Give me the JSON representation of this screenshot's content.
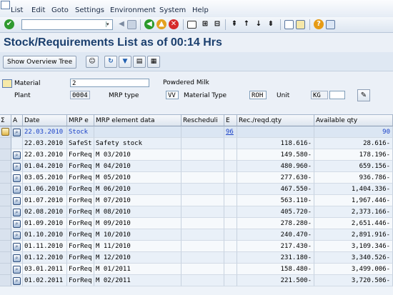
{
  "menu": [
    "List",
    "Edit",
    "Goto",
    "Settings",
    "Environment",
    "System",
    "Help"
  ],
  "toolbar": {
    "command_value": "",
    "icons": [
      "check-icon",
      "back-arrow-icon",
      "save-icon",
      "back-icon",
      "exit-icon",
      "cancel-icon",
      "print-icon",
      "find-icon",
      "find-next-icon",
      "first-page-icon",
      "prev-page-icon",
      "next-page-icon",
      "last-page-icon",
      "new-session-icon",
      "shortcut-icon",
      "help-icon",
      "layout-icon"
    ]
  },
  "title": "Stock/Requirements List as of 00:14 Hrs",
  "app_toolbar": {
    "show_overview_tree": "Show Overview Tree",
    "icons": [
      "person-icon",
      "refresh-icon",
      "filter-icon",
      "print-icon",
      "calendar-icon"
    ]
  },
  "header": {
    "material_label": "Material",
    "material_value": "2",
    "material_desc": "Powdered Milk",
    "plant_label": "Plant",
    "plant_value": "0004",
    "mrp_type_label": "MRP type",
    "mrp_type_value": "VV",
    "material_type_label": "Material Type",
    "material_type_value": "ROH",
    "unit_label": "Unit",
    "unit_value": "KG",
    "unit_extra": "",
    "edit_icon": "pencil-icon"
  },
  "grid": {
    "columns": [
      "A",
      "Date",
      "MRP e",
      "MRP element data",
      "Rescheduli",
      "E",
      "Rec./reqd.qty",
      "Available qty"
    ],
    "rows": [
      {
        "date": "22.03.2010",
        "mrp": "Stock",
        "data": "",
        "resch": "",
        "e": "96",
        "rec": "",
        "avail": "90"
      },
      {
        "date": "22.03.2010",
        "mrp": "SafeSt",
        "data": "Safety stock",
        "resch": "",
        "e": "",
        "rec": "118.616-",
        "avail": "28.616-"
      },
      {
        "date": "22.03.2010",
        "mrp": "ForReq",
        "data": "M 03/2010",
        "resch": "",
        "e": "",
        "rec": "149.580-",
        "avail": "178.196-"
      },
      {
        "date": "01.04.2010",
        "mrp": "ForReq",
        "data": "M 04/2010",
        "resch": "",
        "e": "",
        "rec": "480.960-",
        "avail": "659.156-"
      },
      {
        "date": "03.05.2010",
        "mrp": "ForReq",
        "data": "M 05/2010",
        "resch": "",
        "e": "",
        "rec": "277.630-",
        "avail": "936.786-"
      },
      {
        "date": "01.06.2010",
        "mrp": "ForReq",
        "data": "M 06/2010",
        "resch": "",
        "e": "",
        "rec": "467.550-",
        "avail": "1,404.336-"
      },
      {
        "date": "01.07.2010",
        "mrp": "ForReq",
        "data": "M 07/2010",
        "resch": "",
        "e": "",
        "rec": "563.110-",
        "avail": "1,967.446-"
      },
      {
        "date": "02.08.2010",
        "mrp": "ForReq",
        "data": "M 08/2010",
        "resch": "",
        "e": "",
        "rec": "405.720-",
        "avail": "2,373.166-"
      },
      {
        "date": "01.09.2010",
        "mrp": "ForReq",
        "data": "M 09/2010",
        "resch": "",
        "e": "",
        "rec": "278.280-",
        "avail": "2,651.446-"
      },
      {
        "date": "01.10.2010",
        "mrp": "ForReq",
        "data": "M 10/2010",
        "resch": "",
        "e": "",
        "rec": "240.470-",
        "avail": "2,891.916-"
      },
      {
        "date": "01.11.2010",
        "mrp": "ForReq",
        "data": "M 11/2010",
        "resch": "",
        "e": "",
        "rec": "217.430-",
        "avail": "3,109.346-"
      },
      {
        "date": "01.12.2010",
        "mrp": "ForReq",
        "data": "M 12/2010",
        "resch": "",
        "e": "",
        "rec": "231.180-",
        "avail": "3,340.526-"
      },
      {
        "date": "03.01.2011",
        "mrp": "ForReq",
        "data": "M 01/2011",
        "resch": "",
        "e": "",
        "rec": "158.480-",
        "avail": "3,499.006-"
      },
      {
        "date": "01.02.2011",
        "mrp": "ForReq",
        "data": "M 02/2011",
        "resch": "",
        "e": "",
        "rec": "221.500-",
        "avail": "3,720.506-"
      }
    ]
  }
}
